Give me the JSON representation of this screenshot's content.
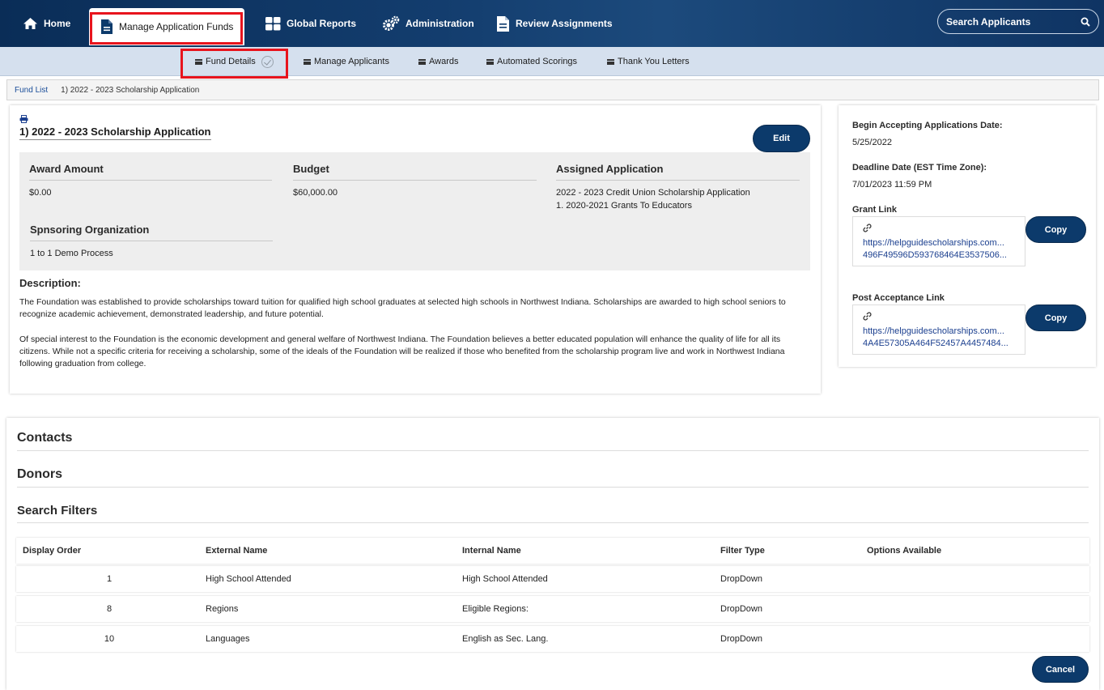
{
  "topnav": {
    "items": [
      {
        "label": "Home",
        "icon": "home-icon"
      },
      {
        "label": "Manage Application Funds",
        "icon": "document-icon"
      },
      {
        "label": "Global Reports",
        "icon": "grid-icon"
      },
      {
        "label": "Administration",
        "icon": "gears-icon"
      },
      {
        "label": "Review Assignments",
        "icon": "document-icon"
      }
    ],
    "search_label": "Search Applicants"
  },
  "subnav": {
    "items": [
      {
        "label": "Fund Details"
      },
      {
        "label": "Manage Applicants"
      },
      {
        "label": "Awards"
      },
      {
        "label": "Automated Scorings"
      },
      {
        "label": "Thank You Letters"
      }
    ]
  },
  "breadcrumb": {
    "root": "Fund List",
    "current": "1) 2022 - 2023 Scholarship Application"
  },
  "fund": {
    "title": "1) 2022 - 2023 Scholarship Application",
    "edit_label": "Edit",
    "award_amount_label": "Award Amount",
    "award_amount": "$0.00",
    "budget_label": "Budget",
    "budget": "$60,000.00",
    "assigned_label": "Assigned Application",
    "assigned_1": "2022 - 2023 Credit Union Scholarship Application",
    "assigned_2": "1. 2020-2021 Grants To Educators",
    "sponsor_label": "Spnsoring Organization",
    "sponsor": "1 to 1 Demo Process",
    "description_label": "Description:",
    "description_p1": "The Foundation was established to provide scholarships toward tuition for qualified high school graduates at selected high schools in Northwest Indiana. Scholarships are awarded to high school seniors to recognize academic achievement, demonstrated leadership, and future potential.",
    "description_p2": "Of special interest to the Foundation is the economic development and general welfare of Northwest Indiana. The Foundation believes a better educated population will enhance the quality of life for all its citizens. While not a specific criteria for receiving a scholarship, some of the ideals of the Foundation will be realized if those who benefited from the scholarship program live and work in Northwest Indiana following graduation from college."
  },
  "sidebar": {
    "begin_label": "Begin Accepting Applications Date:",
    "begin_value": "5/25/2022",
    "deadline_label": "Deadline Date (EST Time Zone):",
    "deadline_value": "7/01/2023 11:59 PM",
    "grant_label": "Grant Link",
    "grant_link_1": "https://helpguidescholarships.com...",
    "grant_link_2": "496F49596D593768464E3537506...",
    "post_label": "Post Acceptance Link",
    "post_link_1": "https://helpguidescholarships.com...",
    "post_link_2": "4A4E57305A464F52457A4457484...",
    "copy_label": "Copy"
  },
  "sections": {
    "contacts": "Contacts",
    "donors": "Donors",
    "search_filters": "Search Filters"
  },
  "table": {
    "headers": [
      "Display Order",
      "External Name",
      "Internal Name",
      "Filter Type",
      "Options Available"
    ],
    "rows": [
      [
        "1",
        "High School Attended",
        "High School Attended",
        "DropDown",
        ""
      ],
      [
        "8",
        "Regions",
        "Eligible Regions:",
        "DropDown",
        ""
      ],
      [
        "10",
        "Languages",
        "English as Sec. Lang.",
        "DropDown",
        ""
      ]
    ]
  },
  "cancel_label": "Cancel",
  "colors": {
    "nav_dark": "#0c3a6b",
    "subnav_bg": "#d5e0ee",
    "highlight_red": "#e8141d",
    "link_blue": "#1b3f8f"
  }
}
